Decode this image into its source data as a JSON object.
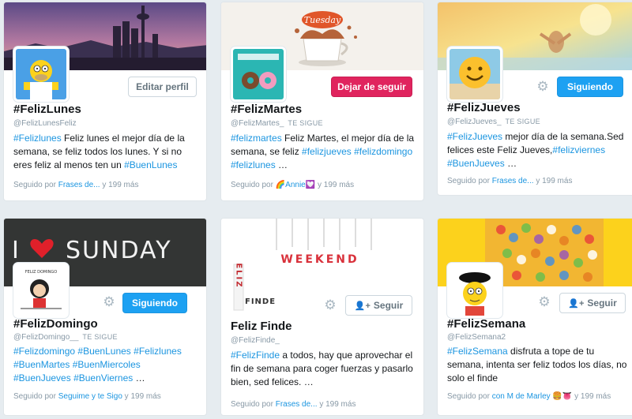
{
  "cards": [
    {
      "name": "#FelizLunes",
      "handle": "@FelizLunesFeliz",
      "follows_you": "",
      "button": "Editar perfil",
      "bio": [
        {
          "t": "#Felizlunes",
          "tag": true
        },
        {
          "t": " Feliz lunes el mejor día de la semana, se feliz todos los lunes. Y si no eres feliz al menos ten un ",
          "tag": false
        },
        {
          "t": "#BuenLunes",
          "tag": true
        }
      ],
      "followed_prefix": "Seguido por",
      "followed_names": "Frases de...",
      "followed_suffix": "y 199 más"
    },
    {
      "name": "#FelizMartes",
      "handle": "@FelizMartes_",
      "follows_you": "TE SIGUE",
      "button": "Dejar de seguir",
      "bio": [
        {
          "t": "#felizmartes",
          "tag": true
        },
        {
          "t": " Feliz Martes, el mejor día de la semana, se feliz ",
          "tag": false
        },
        {
          "t": "#felizjueves",
          "tag": true
        },
        {
          "t": " ",
          "tag": false
        },
        {
          "t": "#felizdomingo",
          "tag": true
        },
        {
          "t": " ",
          "tag": false
        },
        {
          "t": "#felizlunes",
          "tag": true
        },
        {
          "t": " …",
          "tag": false
        }
      ],
      "followed_prefix": "Seguido por",
      "followed_names": "🌈Annie💟",
      "followed_suffix": "y 199 más"
    },
    {
      "name": "#FelizJueves",
      "handle": "@FelizJueves_",
      "follows_you": "TE SIGUE",
      "button": "Siguiendo",
      "bio": [
        {
          "t": "#FelizJueves",
          "tag": true
        },
        {
          "t": " mejor día de la semana.Sed felices este Feliz Jueves,",
          "tag": false
        },
        {
          "t": "#felizviernes",
          "tag": true
        },
        {
          "t": " ",
          "tag": false
        },
        {
          "t": "#BuenJueves",
          "tag": true
        },
        {
          "t": " …",
          "tag": false
        }
      ],
      "followed_prefix": "Seguido por",
      "followed_names": "Frases de...",
      "followed_suffix": "y 199 más"
    },
    {
      "name": "#FelizDomingo",
      "handle": "@FelizDomingo__",
      "follows_you": "TE SIGUE",
      "button": "Siguiendo",
      "bio": [
        {
          "t": "#Felizdomingo",
          "tag": true
        },
        {
          "t": " ",
          "tag": false
        },
        {
          "t": "#BuenLunes",
          "tag": true
        },
        {
          "t": " ",
          "tag": false
        },
        {
          "t": "#Felizlunes",
          "tag": true
        },
        {
          "t": " ",
          "tag": false
        },
        {
          "t": "#BuenMartes",
          "tag": true
        },
        {
          "t": " ",
          "tag": false
        },
        {
          "t": "#BuenMiercoles",
          "tag": true
        },
        {
          "t": " ",
          "tag": false
        },
        {
          "t": "#BuenJueves",
          "tag": true
        },
        {
          "t": " ",
          "tag": false
        },
        {
          "t": "#BuenViernes",
          "tag": true
        },
        {
          "t": " …",
          "tag": false
        }
      ],
      "followed_prefix": "Seguido por",
      "followed_names": "Seguime y te Sigo",
      "followed_suffix": "y 199 más"
    },
    {
      "name": "Feliz Finde",
      "handle": "@FelizFinde_",
      "follows_you": "",
      "button": "Seguir",
      "bio": [
        {
          "t": "#FelizFinde",
          "tag": true
        },
        {
          "t": " a todos, hay que aprovechar el fin de semana para coger fuerzas y pasarlo bien, sed felices. …",
          "tag": false
        }
      ],
      "followed_prefix": "Seguido por",
      "followed_names": "Frases de...",
      "followed_suffix": "y 199 más"
    },
    {
      "name": "#FelizSemana",
      "handle": "@FelizSemana2",
      "follows_you": "",
      "button": "Seguir",
      "bio": [
        {
          "t": "#FelizSemana",
          "tag": true
        },
        {
          "t": " disfruta a tope de tu semana, intenta ser feliz todos los días, no solo el finde",
          "tag": false
        }
      ],
      "followed_prefix": "Seguido por",
      "followed_names": "con M de Marley 🍔👅",
      "followed_suffix": "y 199 más"
    }
  ],
  "banner_text": {
    "tuesday": "Tuesday",
    "sunday_i": "I",
    "sunday_word": "SUNDAY",
    "weekend": "WEEKEND",
    "feliz": "FELIZ",
    "finde": "FINDE",
    "domingo_caption": "FELIZ DOMINGO"
  },
  "icons": {
    "gear": "gear-icon",
    "follow": "add-user-icon"
  },
  "colors": {
    "link": "#1b95e0",
    "following": "#1da1f2",
    "unfollow": "#e0245e",
    "muted": "#8899a6"
  }
}
